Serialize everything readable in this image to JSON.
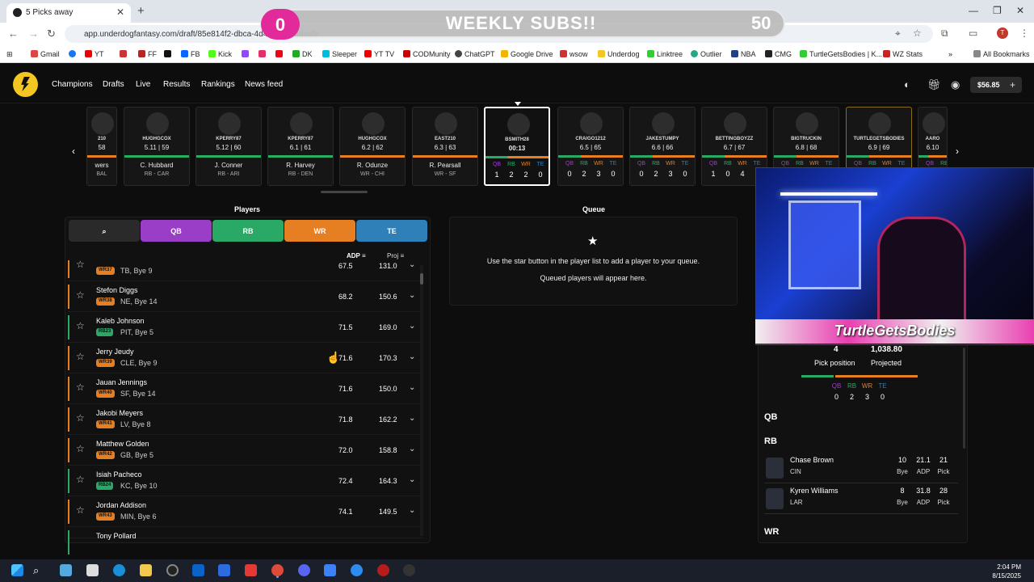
{
  "browser": {
    "tab_title": "5 Picks away",
    "url": "app.underdogfantasy.com/draft/85e814f2-dbca-4d43-...c3d4dadfe",
    "bookmarks": [
      "Gmail",
      "YT",
      "FF",
      "FB",
      "Kick",
      "DK",
      "Sleeper",
      "YT TV",
      "CODMunity",
      "ChatGPT",
      "Google Drive",
      "wsow",
      "Underdog",
      "Linktree",
      "Outlier",
      "NBA",
      "CMG",
      "TurtleGetsBodies | K...",
      "WZ Stats"
    ],
    "all_bookmarks": "All Bookmarks"
  },
  "overlay": {
    "left_count": "0",
    "title": "WEEKLY SUBS!!",
    "right_count": "50"
  },
  "nav": {
    "items": [
      "Champions",
      "Drafts",
      "Live",
      "Results",
      "Rankings",
      "News feed"
    ],
    "balance": "$56.85"
  },
  "board": [
    {
      "user": "210",
      "stat": "58",
      "player": "wers",
      "team": "BAL",
      "bar": "#e67e22"
    },
    {
      "user": "HUGHGCOX",
      "stat": "5.11 | 59",
      "player": "C. Hubbard",
      "team": "RB - CAR",
      "bar": "#27ae60"
    },
    {
      "user": "KPERRY87",
      "stat": "5.12 | 60",
      "player": "J. Conner",
      "team": "RB - ARI",
      "bar": "#27ae60"
    },
    {
      "user": "KPERRY87",
      "stat": "6.1 | 61",
      "player": "R. Harvey",
      "team": "RB - DEN",
      "bar": "#27ae60"
    },
    {
      "user": "HUGHGCOX",
      "stat": "6.2 | 62",
      "player": "R. Odunze",
      "team": "WR - CHI",
      "bar": "#e67e22"
    },
    {
      "user": "EAST210",
      "stat": "6.3 | 63",
      "player": "R. Pearsall",
      "team": "WR - SF",
      "bar": "#e67e22"
    },
    {
      "user": "BSMITH28",
      "stat": "00:13",
      "current": true,
      "counts": [
        "1",
        "2",
        "2",
        "0"
      ]
    },
    {
      "user": "CRAIGO1212",
      "stat": "6.5 | 65",
      "counts": [
        "0",
        "2",
        "3",
        "0"
      ]
    },
    {
      "user": "JAKESTUMPY",
      "stat": "6.6 | 66",
      "counts": [
        "0",
        "2",
        "3",
        "0"
      ]
    },
    {
      "user": "BETTINGBOYZZ",
      "stat": "6.7 | 67",
      "counts": [
        "1",
        "0",
        "4",
        ""
      ]
    },
    {
      "user": "BIGTRUCKIN",
      "stat": "6.8 | 68",
      "counts": [
        "",
        "",
        "",
        ""
      ]
    },
    {
      "user": "TURTLEGETSBODIES",
      "stat": "6.9 | 69",
      "counts": [
        "",
        "",
        "",
        ""
      ]
    },
    {
      "user": "AARO",
      "stat": "6.10",
      "counts": [
        "",
        "",
        "",
        ""
      ]
    }
  ],
  "pos_labels": [
    "QB",
    "RB",
    "WR",
    "TE"
  ],
  "players_panel": {
    "title": "Players",
    "filters": [
      "QB",
      "RB",
      "WR",
      "TE"
    ],
    "col_adp": "ADP",
    "col_proj": "Proj",
    "rows": [
      {
        "name": "",
        "badge": "WR37",
        "team": "TB, Bye 9",
        "adp": "67.5",
        "proj": "131.0",
        "pos": "wr"
      },
      {
        "name": "Stefon Diggs",
        "badge": "WR38",
        "team": "NE, Bye 14",
        "adp": "68.2",
        "proj": "150.6",
        "pos": "wr"
      },
      {
        "name": "Kaleb Johnson",
        "badge": "RB23",
        "team": "PIT, Bye 5",
        "adp": "71.5",
        "proj": "169.0",
        "pos": "rb"
      },
      {
        "name": "Jerry Jeudy",
        "badge": "WR39",
        "team": "CLE, Bye 9",
        "adp": "71.6",
        "proj": "170.3",
        "pos": "wr"
      },
      {
        "name": "Jauan Jennings",
        "badge": "WR40",
        "team": "SF, Bye 14",
        "adp": "71.6",
        "proj": "150.0",
        "pos": "wr"
      },
      {
        "name": "Jakobi Meyers",
        "badge": "WR41",
        "team": "LV, Bye 8",
        "adp": "71.8",
        "proj": "162.2",
        "pos": "wr"
      },
      {
        "name": "Matthew Golden",
        "badge": "WR42",
        "team": "GB, Bye 5",
        "adp": "72.0",
        "proj": "158.8",
        "pos": "wr"
      },
      {
        "name": "Isiah Pacheco",
        "badge": "RB24",
        "team": "KC, Bye 10",
        "adp": "72.4",
        "proj": "164.3",
        "pos": "rb"
      },
      {
        "name": "Jordan Addison",
        "badge": "WR43",
        "team": "MIN, Bye 6",
        "adp": "74.1",
        "proj": "149.5",
        "pos": "wr"
      },
      {
        "name": "Tony Pollard",
        "badge": "",
        "team": "",
        "adp": "",
        "proj": "",
        "pos": "rb"
      }
    ]
  },
  "queue": {
    "title": "Queue",
    "line1": "Use the star button in the player list to add a player to your queue.",
    "line2": "Queued players will appear here."
  },
  "summary": {
    "pick_position": "4",
    "projected": "1,038.80",
    "pick_position_label": "Pick position",
    "projected_label": "Projected",
    "counts": [
      "0",
      "2",
      "3",
      "0"
    ],
    "sections": [
      "QB",
      "RB",
      "WR"
    ],
    "picks": [
      {
        "name": "Chase Brown",
        "team": "CIN",
        "bye": "10",
        "adp": "21.1",
        "pick": "21"
      },
      {
        "name": "Kyren Williams",
        "team": "LAR",
        "bye": "8",
        "adp": "31.8",
        "pick": "28"
      }
    ],
    "col_labels": [
      "Bye",
      "ADP",
      "Pick"
    ]
  },
  "webcam_text": "TurtleGetsBodies",
  "clock": {
    "time": "2:04 PM",
    "date": "8/15/2025"
  },
  "colors": {
    "qb": "#9b3ec7",
    "rb": "#2aa866",
    "wr": "#e67e22",
    "te": "#2f7fb8"
  }
}
